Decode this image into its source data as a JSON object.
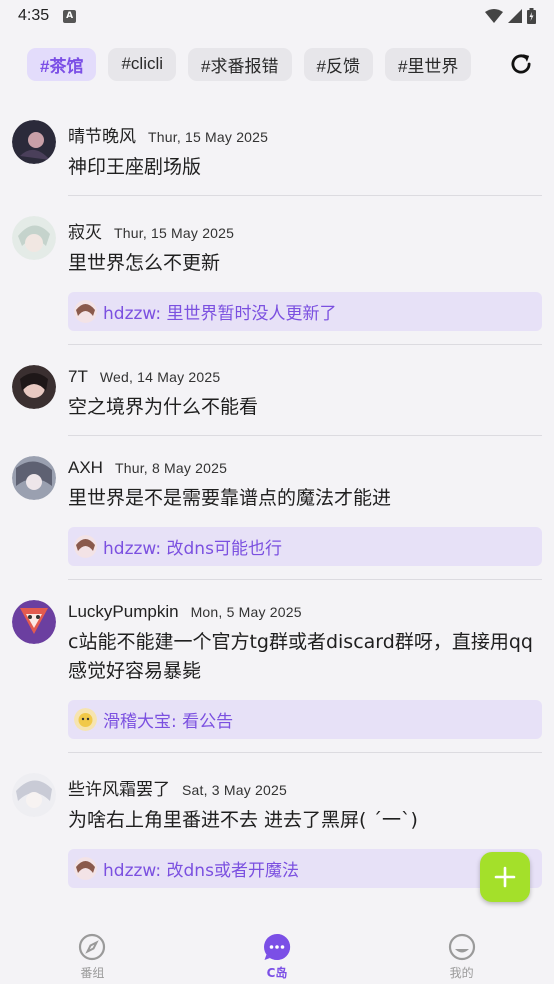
{
  "status": {
    "time": "4:35",
    "badge": "A"
  },
  "tabs": [
    {
      "label": "#茶馆",
      "active": true
    },
    {
      "label": "#clicli",
      "active": false
    },
    {
      "label": "#求番报错",
      "active": false
    },
    {
      "label": "#反馈",
      "active": false
    },
    {
      "label": "#里世界",
      "active": false
    }
  ],
  "posts": [
    {
      "author": "晴节晚风",
      "date": "Thur, 15 May 2025",
      "content": "神印王座剧场版",
      "avatar_color": "#2b2a3a"
    },
    {
      "author": "寂灭",
      "date": "Thur, 15 May 2025",
      "content": "里世界怎么不更新",
      "avatar_color": "#cfd8d3",
      "reply": {
        "text": "hdzzw: 里世界暂时没人更新了"
      }
    },
    {
      "author": "7T",
      "date": "Wed, 14 May 2025",
      "content": "空之境界为什么不能看",
      "avatar_color": "#3a2f30"
    },
    {
      "author": "AXH",
      "date": "Thur, 8 May 2025",
      "content": "里世界是不是需要靠谱点的魔法才能进",
      "avatar_color": "#8a8fa0",
      "reply": {
        "text": "hdzzw: 改dns可能也行"
      }
    },
    {
      "author": "LuckyPumpkin",
      "date": "Mon, 5 May 2025",
      "content": "c站能不能建一个官方tg群或者discard群呀，直接用qq感觉好容易暴毙",
      "avatar_color": "#6b3fa0",
      "reply": {
        "text": "滑稽大宝: 看公告"
      }
    },
    {
      "author": "些许风霜罢了",
      "date": "Sat, 3 May 2025",
      "content": "为啥右上角里番进不去 进去了黑屏( ´一`)",
      "avatar_color": "#e6e6ea",
      "reply": {
        "text": "hdzzw: 改dns或者开魔法"
      }
    }
  ],
  "nav": [
    {
      "label": "番组",
      "icon": "compass-icon",
      "active": false
    },
    {
      "label": "C岛",
      "icon": "chat-bubble-icon",
      "active": true
    },
    {
      "label": "我的",
      "icon": "face-icon",
      "active": false
    }
  ],
  "colors": {
    "accent": "#7b4fe6",
    "fab": "#a4e02a",
    "reply_bg": "#e7e1f7"
  }
}
